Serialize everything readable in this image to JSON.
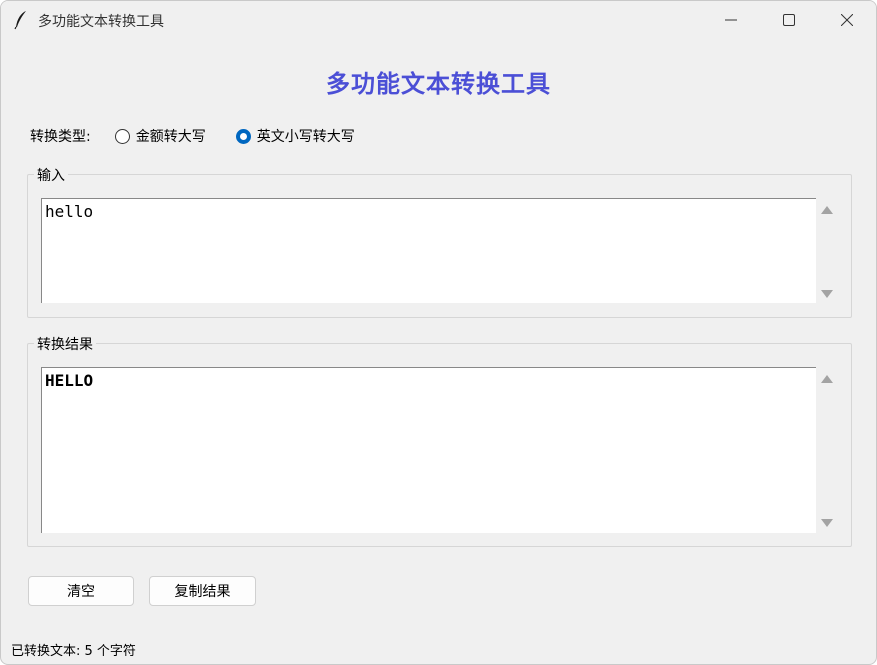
{
  "window": {
    "title": "多功能文本转换工具",
    "icons": {
      "app": "feather-icon",
      "minimize": "minimize-icon",
      "maximize": "maximize-icon",
      "close": "close-icon"
    }
  },
  "header": {
    "title": "多功能文本转换工具",
    "color": "#4b4fd6"
  },
  "conversion": {
    "label": "转换类型:",
    "options": [
      {
        "label": "金额转大写",
        "selected": false
      },
      {
        "label": "英文小写转大写",
        "selected": true
      }
    ],
    "accent": "#0067c0"
  },
  "input": {
    "legend": "输入",
    "value": "hello"
  },
  "output": {
    "legend": "转换结果",
    "value": "HELLO"
  },
  "buttons": {
    "clear": "清空",
    "copy": "复制结果"
  },
  "status": {
    "text": "已转换文本: 5 个字符"
  }
}
